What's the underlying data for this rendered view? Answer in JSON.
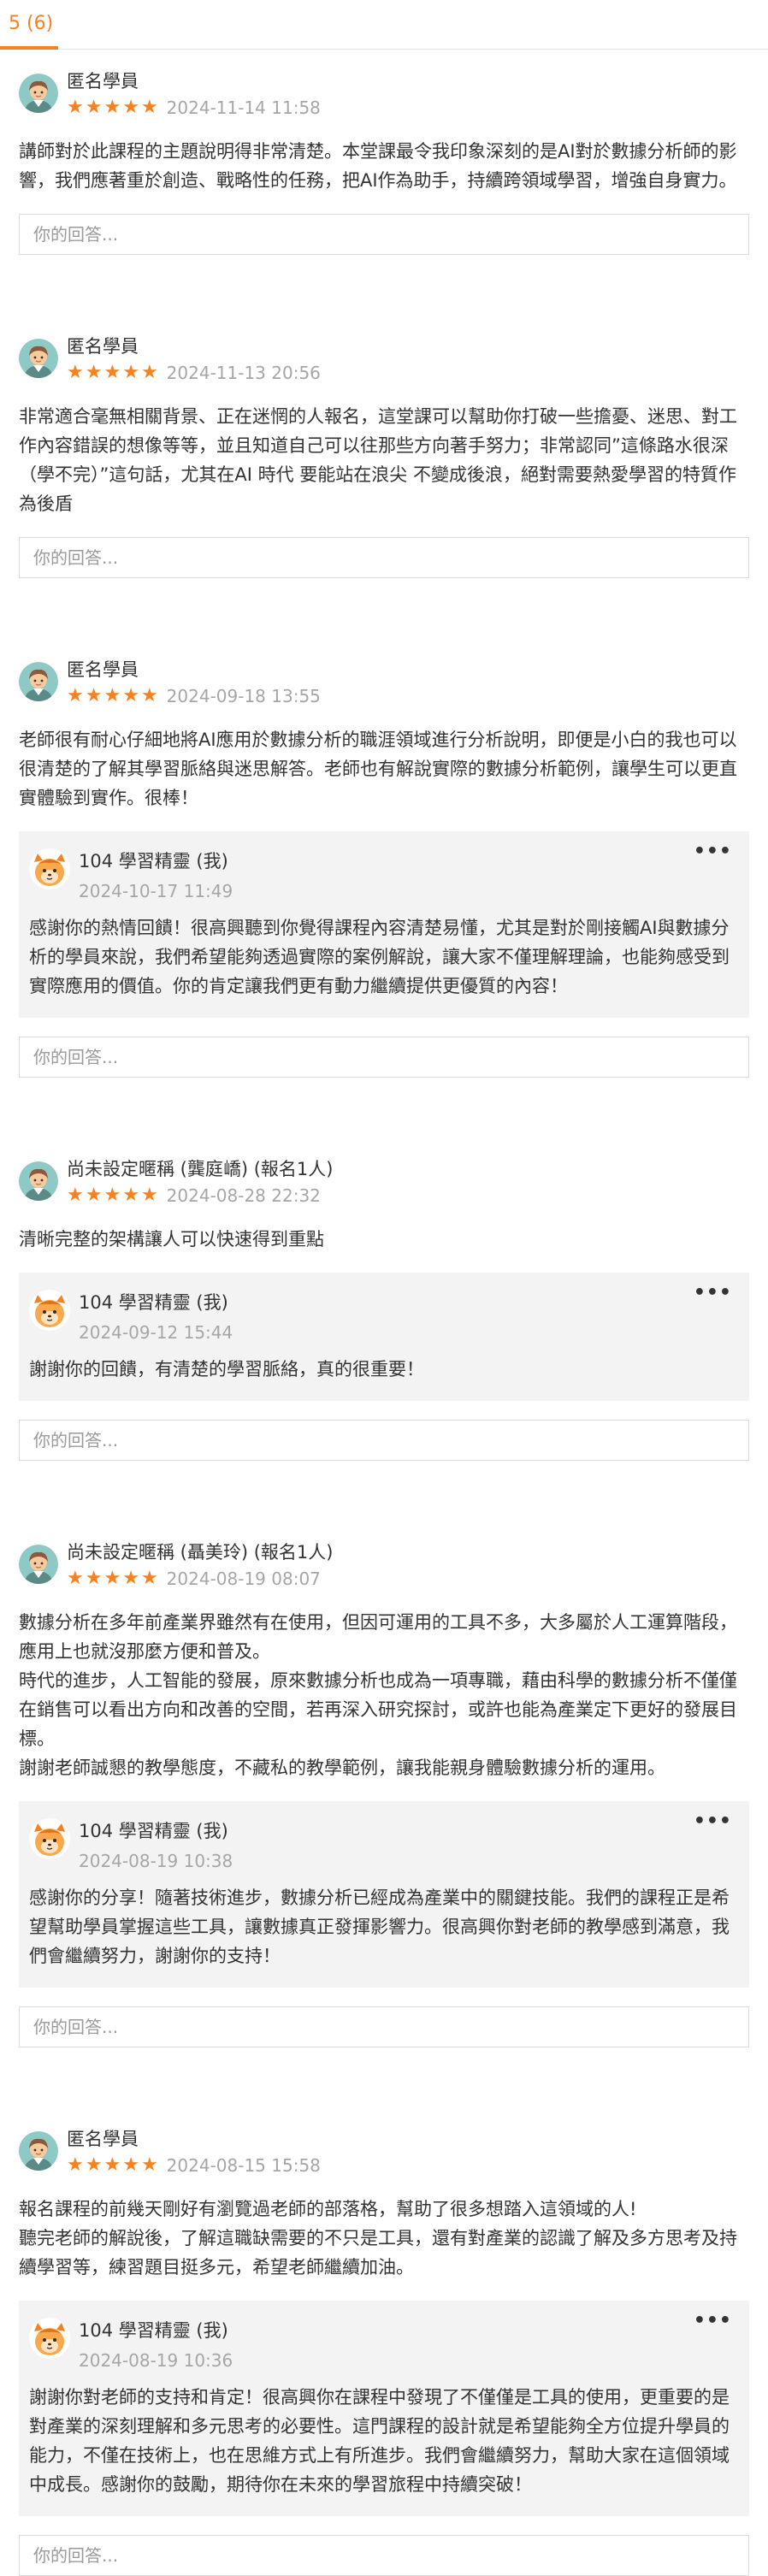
{
  "tabs": {
    "active_label": "5 (6)"
  },
  "colors": {
    "accent": "#f58220",
    "star": "#f58220",
    "muted": "#a6a6a6",
    "reply_bg": "#f3f3f3"
  },
  "answer_placeholder": "你的回答...",
  "reviews": [
    {
      "author": "匿名學員",
      "rating": 5,
      "date": "2024-11-14 11:58",
      "avatar_icon": "anonymous-avatar-icon",
      "body": "講師對於此課程的主題說明得非常清楚。本堂課最令我印象深刻的是AI對於數據分析師的影響，我們應著重於創造、戰略性的任務，把AI作為助手，持續跨領域學習，增強自身實力。"
    },
    {
      "author": "匿名學員",
      "rating": 5,
      "date": "2024-11-13 20:56",
      "avatar_icon": "anonymous-avatar-icon",
      "body": "非常適合毫無相關背景、正在迷惘的人報名，這堂課可以幫助你打破一些擔憂、迷思、對工作內容錯誤的想像等等，並且知道自己可以往那些方向著手努力；非常認同”這條路水很深（學不完）”這句話，尤其在AI 時代 要能站在浪尖 不變成後浪，絕對需要熱愛學習的特質作為後盾"
    },
    {
      "author": "匿名學員",
      "rating": 5,
      "date": "2024-09-18 13:55",
      "avatar_icon": "anonymous-avatar-icon",
      "body": "老師很有耐心仔細地將AI應用於數據分析的職涯領域進行分析說明，即便是小白的我也可以很清楚的了解其學習脈絡與迷思解答。老師也有解說實際的數據分析範例，讓學生可以更直實體驗到實作。很棒！",
      "reply": {
        "name": "104 學習精靈 (我)",
        "date": "2024-10-17 11:49",
        "more_label": "•••",
        "body": "感謝你的熱情回饋！很高興聽到你覺得課程內容清楚易懂，尤其是對於剛接觸AI與數據分析的學員來說，我們希望能夠透過實際的案例解說，讓大家不僅理解理論，也能夠感受到實際應用的價值。你的肯定讓我們更有動力繼續提供更優質的內容！"
      }
    },
    {
      "author": "尚未設定暱稱 (龔庭嶠) (報名1人)",
      "rating": 5,
      "date": "2024-08-28 22:32",
      "avatar_icon": "anonymous-avatar-icon",
      "body": "清晰完整的架構讓人可以快速得到重點",
      "reply": {
        "name": "104 學習精靈 (我)",
        "date": "2024-09-12 15:44",
        "more_label": "•••",
        "body": "謝謝你的回饋，有清楚的學習脈絡，真的很重要！"
      }
    },
    {
      "author": "尚未設定暱稱 (聶美玲) (報名1人)",
      "rating": 5,
      "date": "2024-08-19 08:07",
      "avatar_icon": "anonymous-avatar-icon",
      "body": "數據分析在多年前產業界雖然有在使用，但因可運用的工具不多，大多屬於人工運算階段，應用上也就沒那麼方便和普及。\n時代的進步，人工智能的發展，原來數據分析也成為一項專職，藉由科學的數據分析不僅僅在銷售可以看出方向和改善的空間，若再深入研究探討，或許也能為產業定下更好的發展目標。\n謝謝老師誠懇的教學態度，不藏私的教學範例，讓我能親身體驗數據分析的運用。",
      "reply": {
        "name": "104 學習精靈 (我)",
        "date": "2024-08-19 10:38",
        "more_label": "•••",
        "body": "感謝你的分享！隨著技術進步，數據分析已經成為產業中的關鍵技能。我們的課程正是希望幫助學員掌握這些工具，讓數據真正發揮影響力。很高興你對老師的教學感到滿意，我們會繼續努力，謝謝你的支持！"
      }
    },
    {
      "author": "匿名學員",
      "rating": 5,
      "date": "2024-08-15 15:58",
      "avatar_icon": "anonymous-avatar-icon",
      "body": "報名課程的前幾天剛好有瀏覽過老師的部落格，幫助了很多想踏入這領域的人!\n聽完老師的解說後，了解這職缺需要的不只是工具，還有對產業的認識了解及多方思考及持續學習等，練習題目挺多元，希望老師繼續加油。",
      "reply": {
        "name": "104 學習精靈 (我)",
        "date": "2024-08-19 10:36",
        "more_label": "•••",
        "body": "謝謝你對老師的支持和肯定！很高興你在課程中發現了不僅僅是工具的使用，更重要的是對產業的深刻理解和多元思考的必要性。這門課程的設計就是希望能夠全方位提升學員的能力，不僅在技術上，也在思維方式上有所進步。我們會繼續努力，幫助大家在這個領域中成長。感謝你的鼓勵，期待你在未來的學習旅程中持續突破！"
      }
    }
  ]
}
